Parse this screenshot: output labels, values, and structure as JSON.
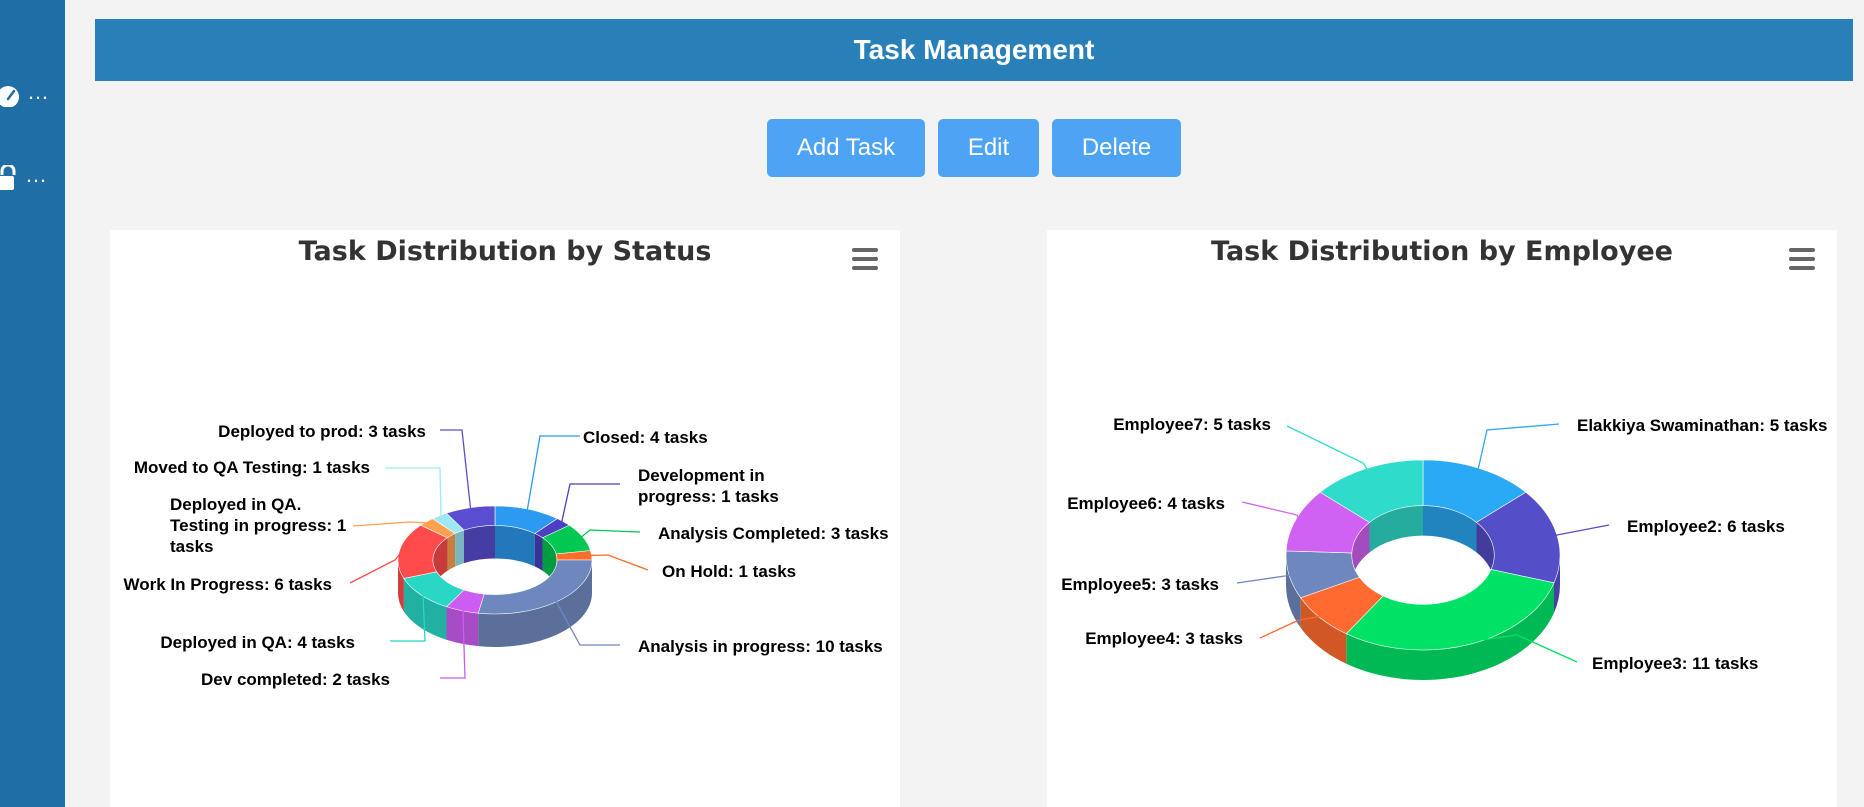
{
  "sidebar": {
    "items": [
      {
        "icon": "dashboard-gauge-icon",
        "label": "…"
      },
      {
        "icon": "lock-icon",
        "label": "…"
      }
    ]
  },
  "header": {
    "title": "Task Management"
  },
  "toolbar": {
    "add_label": "Add Task",
    "edit_label": "Edit",
    "delete_label": "Delete"
  },
  "colors": {
    "sidebar": "#1f6ea6",
    "header": "#2980b9",
    "button": "#4ea4f4"
  },
  "chart_data": [
    {
      "type": "pie",
      "style": "3d-donut",
      "title": "Task Distribution by Status",
      "unit": "tasks",
      "slices": [
        {
          "name": "Closed",
          "value": 4,
          "color": "#2b9af0"
        },
        {
          "name": "Development in progress",
          "value": 1,
          "color": "#4d3fc1"
        },
        {
          "name": "Analysis Completed",
          "value": 3,
          "color": "#00c853"
        },
        {
          "name": "On Hold",
          "value": 1,
          "color": "#ff6d2a"
        },
        {
          "name": "Analysis in progress",
          "value": 10,
          "color": "#6e88bd"
        },
        {
          "name": "Dev completed",
          "value": 2,
          "color": "#cc5cf2"
        },
        {
          "name": "Deployed in QA",
          "value": 4,
          "color": "#28d7c4"
        },
        {
          "name": "Work In Progress",
          "value": 6,
          "color": "#ff4b4b"
        },
        {
          "name": "Deployed in QA. Testing in progress",
          "value": 1,
          "color": "#ffa14f"
        },
        {
          "name": "Moved to QA Testing",
          "value": 1,
          "color": "#9ee8f2"
        },
        {
          "name": "Deployed to prod",
          "value": 3,
          "color": "#5a4ed0"
        }
      ],
      "labels": [
        {
          "lines": [
            "Closed: 4 tasks"
          ]
        },
        {
          "lines": [
            "Development in",
            "progress: 1 tasks"
          ]
        },
        {
          "lines": [
            "Analysis Completed: 3 tasks"
          ]
        },
        {
          "lines": [
            "On Hold: 1 tasks"
          ]
        },
        {
          "lines": [
            "Analysis in progress: 10 tasks"
          ]
        },
        {
          "lines": [
            "Dev completed: 2 tasks"
          ]
        },
        {
          "lines": [
            "Deployed in QA: 4 tasks"
          ]
        },
        {
          "lines": [
            "Work In Progress: 6 tasks"
          ]
        },
        {
          "lines": [
            "Deployed in QA.",
            "Testing in progress: 1",
            "tasks"
          ]
        },
        {
          "lines": [
            "Moved to QA Testing: 1 tasks"
          ]
        },
        {
          "lines": [
            "Deployed to prod: 3 tasks"
          ]
        }
      ]
    },
    {
      "type": "pie",
      "style": "3d-donut",
      "title": "Task Distribution by Employee",
      "unit": "tasks",
      "slices": [
        {
          "name": "Elakkiya Swaminathan",
          "value": 5,
          "color": "#2aa9f5"
        },
        {
          "name": "Employee2",
          "value": 6,
          "color": "#554ec9"
        },
        {
          "name": "Employee3",
          "value": 11,
          "color": "#00e266"
        },
        {
          "name": "Employee4",
          "value": 3,
          "color": "#ff6a30"
        },
        {
          "name": "Employee5",
          "value": 3,
          "color": "#6e88bd"
        },
        {
          "name": "Employee6",
          "value": 4,
          "color": "#d062f3"
        },
        {
          "name": "Employee7",
          "value": 5,
          "color": "#2fdccb"
        }
      ],
      "labels": [
        {
          "lines": [
            "Elakkiya Swaminathan: 5 tasks"
          ]
        },
        {
          "lines": [
            "Employee2: 6 tasks"
          ]
        },
        {
          "lines": [
            "Employee3: 11 tasks"
          ]
        },
        {
          "lines": [
            "Employee4: 3 tasks"
          ]
        },
        {
          "lines": [
            "Employee5: 3 tasks"
          ]
        },
        {
          "lines": [
            "Employee6: 4 tasks"
          ]
        },
        {
          "lines": [
            "Employee7: 5 tasks"
          ]
        }
      ]
    }
  ]
}
